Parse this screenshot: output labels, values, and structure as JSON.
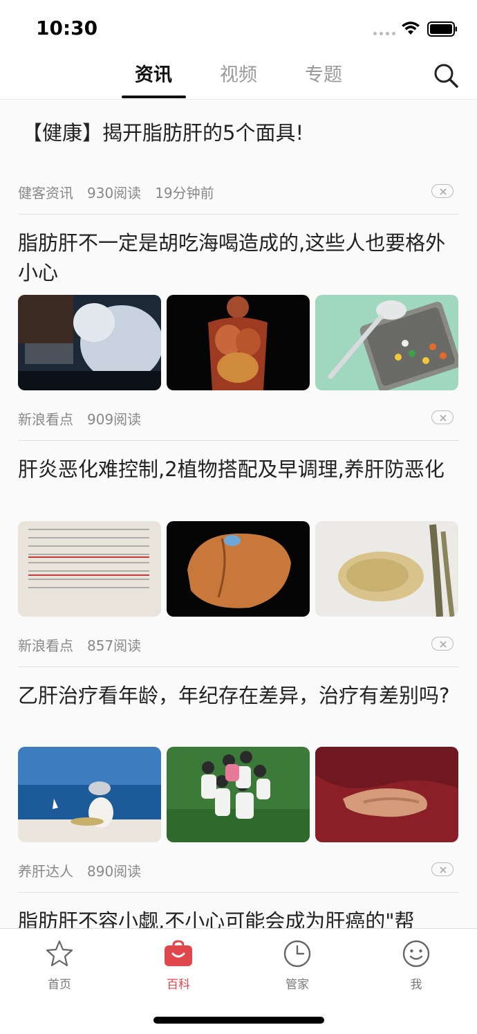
{
  "status": {
    "time": "10:30"
  },
  "tabs": [
    {
      "label": "资讯",
      "active": true
    },
    {
      "label": "视频",
      "active": false
    },
    {
      "label": "专题",
      "active": false
    }
  ],
  "articles": [
    {
      "title": "【健康】揭开脂肪肝的5个面具!",
      "source": "健客资讯",
      "reads": "930阅读",
      "time": "19分钟前",
      "images": []
    },
    {
      "title": "脂肪肝不一定是胡吃海喝造成的,这些人也要格外小心",
      "source": "新浪看点",
      "reads": "909阅读",
      "time": "",
      "images": [
        "man-sitting-photo",
        "anatomy-photo",
        "pills-spoon-photo"
      ]
    },
    {
      "title": "肝炎恶化难控制,2植物搭配及早调理,养肝防恶化",
      "source": "新浪看点",
      "reads": "857阅读",
      "time": "",
      "images": [
        "lab-report-photo",
        "liver-photo",
        "seeds-photo"
      ]
    },
    {
      "title": "乙肝治疗看年龄，年纪存在差异，治疗有差别吗?",
      "source": "养肝达人",
      "reads": "890阅读",
      "time": "",
      "images": [
        "beach-child-photo",
        "group-photo",
        "hands-photo"
      ]
    },
    {
      "title": "脂肪肝不容小觑,不小心可能会成为肝癌的\"帮",
      "source": "",
      "reads": "",
      "time": "",
      "images": []
    }
  ],
  "tabbar": [
    {
      "label": "首页",
      "icon": "star-icon",
      "active": false
    },
    {
      "label": "百科",
      "icon": "encyclopedia-icon",
      "active": true
    },
    {
      "label": "管家",
      "icon": "clock-icon",
      "active": false
    },
    {
      "label": "我",
      "icon": "smiley-icon",
      "active": false
    }
  ],
  "colors": {
    "accent": "#e0474c",
    "text": "#222222",
    "meta": "#888888"
  }
}
